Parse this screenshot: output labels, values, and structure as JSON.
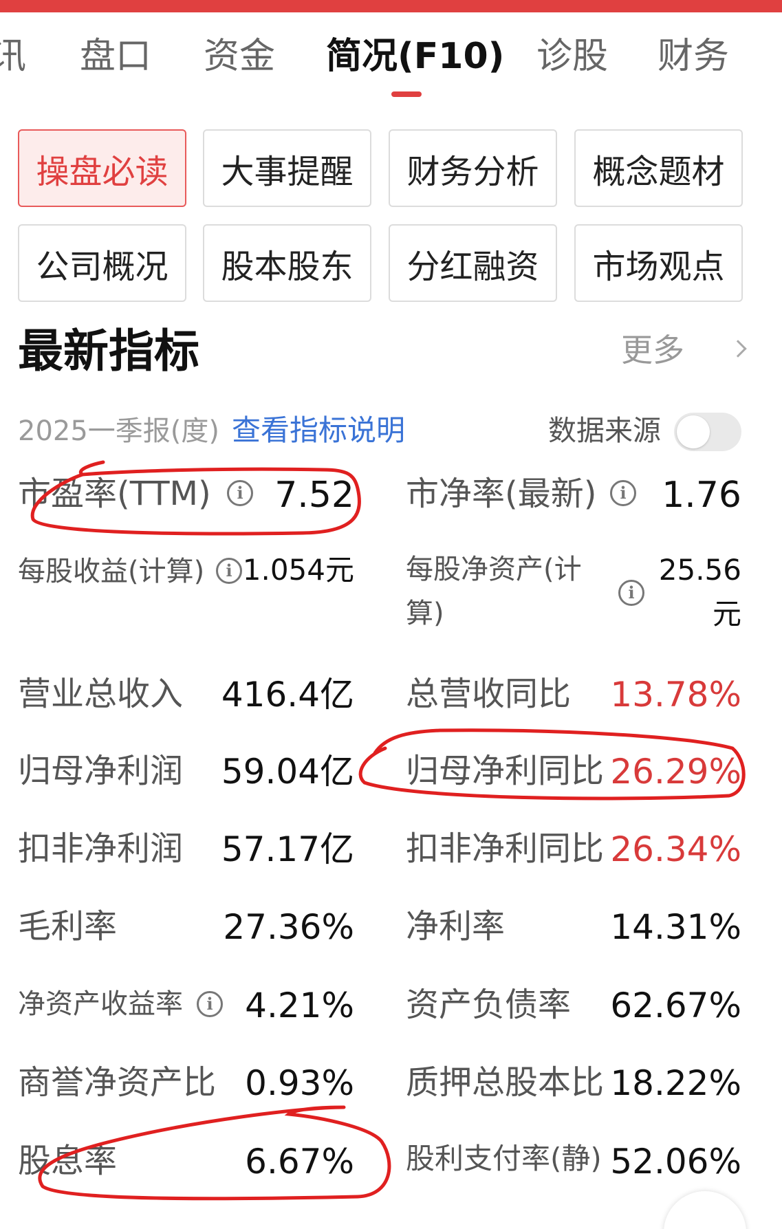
{
  "tabs": [
    {
      "label": "讯"
    },
    {
      "label": "盘口"
    },
    {
      "label": "资金"
    },
    {
      "label": "简况(F10)"
    },
    {
      "label": "诊股"
    },
    {
      "label": "财务"
    }
  ],
  "buttons": [
    {
      "label": "操盘必读"
    },
    {
      "label": "大事提醒"
    },
    {
      "label": "财务分析"
    },
    {
      "label": "概念题材"
    },
    {
      "label": "公司概况"
    },
    {
      "label": "股本股东"
    },
    {
      "label": "分红融资"
    },
    {
      "label": "市场观点"
    }
  ],
  "section": {
    "title": "最新指标",
    "more": "更多",
    "report_period": "2025一季报(度)",
    "explain_link": "查看指标说明",
    "data_source_label": "数据来源"
  },
  "metrics": {
    "pe_label": "市盈率(TTM)",
    "pe_value": "7.52",
    "pb_label": "市净率(最新)",
    "pb_value": "1.76",
    "eps_label": "每股收益(计算)",
    "eps_value": "1.054元",
    "bps_label_1": "每股净资产(计",
    "bps_label_2": "算)",
    "bps_value_1": "25.56",
    "bps_value_2": "元",
    "revenue_label": "营业总收入",
    "revenue_value": "416.4亿",
    "revenue_yoy_label": "总营收同比",
    "revenue_yoy_value": "13.78%",
    "net_profit_label": "归母净利润",
    "net_profit_value": "59.04亿",
    "net_profit_yoy_label": "归母净利同比",
    "net_profit_yoy_value": "26.29%",
    "deducted_profit_label": "扣非净利润",
    "deducted_profit_value": "57.17亿",
    "deducted_profit_yoy_label": "扣非净利同比",
    "deducted_profit_yoy_value": "26.34%",
    "gross_margin_label": "毛利率",
    "gross_margin_value": "27.36%",
    "net_margin_label": "净利率",
    "net_margin_value": "14.31%",
    "roe_label": "净资产收益率",
    "roe_value": "4.21%",
    "debt_ratio_label": "资产负债率",
    "debt_ratio_value": "62.67%",
    "goodwill_label": "商誉净资产比",
    "goodwill_value": "0.93%",
    "pledge_label": "质押总股本比",
    "pledge_value": "18.22%",
    "dividend_yield_label": "股息率",
    "dividend_yield_value": "6.67%",
    "payout_label": "股利支付率(静)",
    "payout_value": "52.06%"
  },
  "colors": {
    "accent": "#e04040",
    "link": "#3a73d6",
    "positive": "#d83a3a",
    "annotation": "#e02020"
  },
  "icons": {
    "info": "info-icon",
    "chevron": "chevron-right-icon"
  }
}
